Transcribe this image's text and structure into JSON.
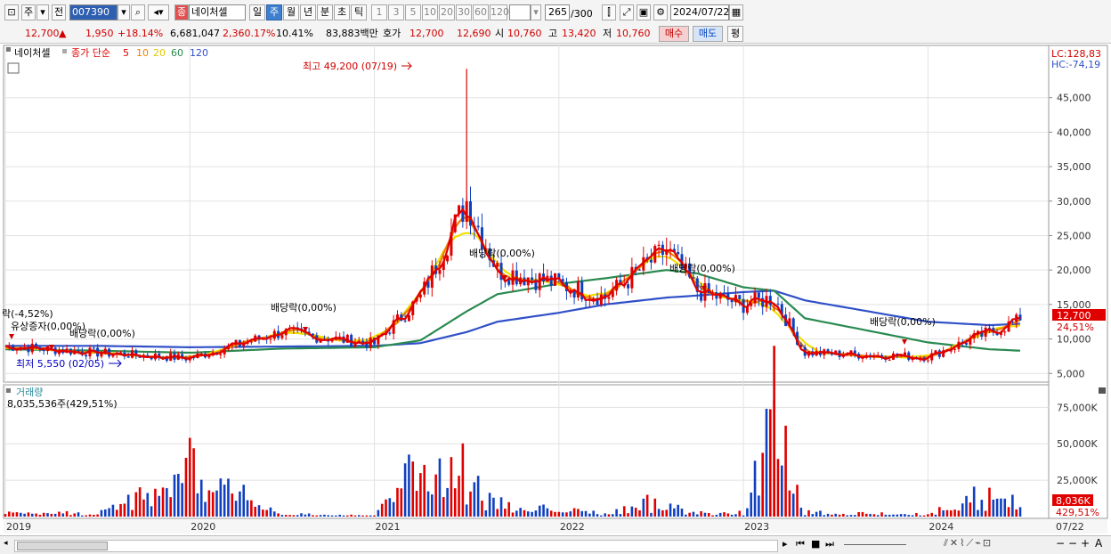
{
  "toolbar": {
    "period_main": "주",
    "prev_label": "전",
    "code": "007390",
    "name_tag": "종",
    "name": "네이처셀",
    "tabs": [
      "일",
      "주",
      "월",
      "년",
      "분",
      "초",
      "틱"
    ],
    "active_tab": "주",
    "intervals": [
      "1",
      "3",
      "5",
      "10",
      "20",
      "30",
      "60",
      "120"
    ],
    "count": "265",
    "count_total": "/300",
    "date": "2024/07/22"
  },
  "quote": {
    "price": "12,700",
    "arrow": "▲",
    "change": "1,950",
    "change_pct": "+18.14%",
    "volume": "6,681,047",
    "volume_pct": "2,360.17%",
    "turnover": "10.41%",
    "amount": "83,883백만",
    "hoga_label": "호가",
    "ask": "12,700",
    "bid": "12,690",
    "open_label": "시",
    "open": "10,760",
    "high_label": "고",
    "high": "13,420",
    "low_label": "저",
    "low": "10,760",
    "buy_label": "매수",
    "sell_label": "매도",
    "avg_label": "평"
  },
  "legend": {
    "name": "네이처셀",
    "series_label": "종가 단순",
    "ma": [
      {
        "period": "5",
        "color": "#e00000"
      },
      {
        "period": "10",
        "color": "#f08000"
      },
      {
        "period": "20",
        "color": "#f0e000"
      },
      {
        "period": "60",
        "color": "#2a8a50"
      },
      {
        "period": "120",
        "color": "#3050c8"
      }
    ]
  },
  "annotations": {
    "high": "최고 49,200 (07/19)",
    "low": "최저 5,550 (02/05)",
    "left_pct": "락(-4,52%)",
    "rights_issue": "유상증자(0,00%)",
    "div_2019": "배당락(0,00%)",
    "div_2021": "배당락(0,00%)",
    "div_2022": "배당락(0,00%)",
    "div_2023": "배당락(0,00%)",
    "div_2024": "배당락(0,00%)"
  },
  "right_axis": {
    "lc": "LC:128,83",
    "hc": "HC:-74,19",
    "price_ticks": [
      "45,000",
      "40,000",
      "35,000",
      "30,000",
      "25,000",
      "20,000",
      "15,000",
      "10,000",
      "5,000"
    ],
    "cur_price": "12,700",
    "cur_pct": "24,51%",
    "volume_ticks": [
      "75,000K",
      "50,000K",
      "25,000K"
    ],
    "cur_volume": "8,036K",
    "cur_volume_pct": "429,51%"
  },
  "volume_panel": {
    "title": "거래량",
    "value": "8,035,536주(429,51%)"
  },
  "x_axis": {
    "labels": [
      "2019",
      "2020",
      "2021",
      "2022",
      "2023",
      "2024"
    ],
    "end_label": "07/22"
  },
  "chart_data": {
    "type": "candlestick",
    "period": "weekly",
    "x": [
      "2019-01",
      "2019-07",
      "2020-01",
      "2020-07",
      "2021-01",
      "2021-04",
      "2021-07",
      "2021-09",
      "2022-01",
      "2022-04",
      "2022-08",
      "2022-10",
      "2023-01",
      "2023-03",
      "2023-05",
      "2024-01",
      "2024-05",
      "2024-07"
    ],
    "close": [
      9000,
      8000,
      7200,
      11000,
      9300,
      16000,
      30000,
      20000,
      18000,
      16000,
      23000,
      17000,
      15000,
      16000,
      8000,
      7400,
      11000,
      12700
    ],
    "ma120": [
      9000,
      9000,
      8800,
      8900,
      9000,
      9400,
      11000,
      12500,
      13800,
      15000,
      16000,
      16300,
      16800,
      17000,
      15600,
      12500,
      12000,
      12200
    ],
    "ma60": [
      8500,
      8300,
      8000,
      8600,
      8800,
      9800,
      14000,
      16500,
      18000,
      18800,
      20000,
      19500,
      17500,
      17000,
      13000,
      9500,
      8500,
      8300
    ],
    "volume_k": [
      3000,
      2500,
      38000,
      2000,
      1500,
      45000,
      30000,
      8000,
      6000,
      3000,
      12000,
      3000,
      3000,
      80000,
      3000,
      2000,
      20000,
      8036
    ],
    "price_ylim": [
      4000,
      50000
    ],
    "volume_ylim": [
      0,
      85000
    ]
  }
}
